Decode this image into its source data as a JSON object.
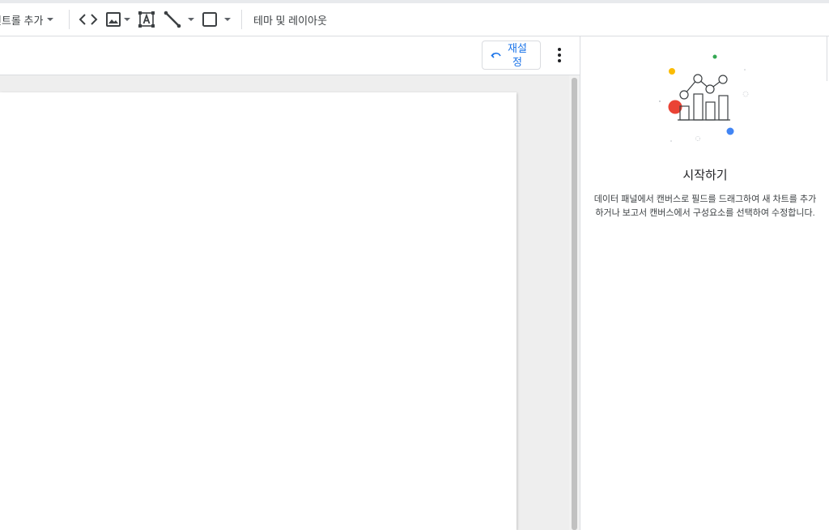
{
  "toolbar": {
    "add_control_label": "컨트롤 추가",
    "theme_layout_label": "테마 및 레이아웃"
  },
  "canvas": {
    "reset_label": "재설정"
  },
  "side_panel": {
    "title": "시작하기",
    "description": "데이터 패널에서 캔버스로 필드를 드래그하여 새 차트를 추가하거나 보고서 캔버스에서 구성요소를 선택하여 수정합니다."
  },
  "colors": {
    "accent_blue": "#1a73e8",
    "red": "#ea4335",
    "yellow": "#fbbc04",
    "green": "#34a853",
    "blue_dot": "#4285f4"
  },
  "icons": [
    "code-icon",
    "image-icon",
    "text-box-icon",
    "line-icon",
    "shape-icon",
    "undo-icon",
    "more-vert-icon"
  ]
}
